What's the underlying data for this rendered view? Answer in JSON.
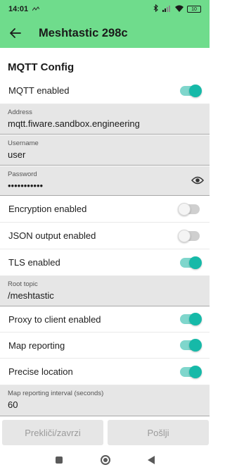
{
  "status_bar": {
    "time": "14:01",
    "battery": "10",
    "icons": [
      "activity-icon",
      "bluetooth-icon",
      "signal-icon",
      "wifi-icon",
      "battery-icon"
    ]
  },
  "app_bar": {
    "title": "Meshtastic 298c",
    "back_icon": "arrow-left-icon"
  },
  "section": {
    "title": "MQTT Config"
  },
  "settings": {
    "mqtt_enabled": {
      "label": "MQTT enabled",
      "on": true
    },
    "address": {
      "label": "Address",
      "value": "mqtt.fiware.sandbox.engineering"
    },
    "username": {
      "label": "Username",
      "value": "user"
    },
    "password": {
      "label": "Password",
      "value": "•••••••••••"
    },
    "encryption_enabled": {
      "label": "Encryption enabled",
      "on": false
    },
    "json_output_enabled": {
      "label": "JSON output enabled",
      "on": false
    },
    "tls_enabled": {
      "label": "TLS enabled",
      "on": true
    },
    "root_topic": {
      "label": "Root topic",
      "value": "/meshtastic"
    },
    "proxy_to_client": {
      "label": "Proxy to client enabled",
      "on": true
    },
    "map_reporting": {
      "label": "Map reporting",
      "on": true
    },
    "precise_location": {
      "label": "Precise location",
      "on": true
    },
    "map_interval": {
      "label": "Map reporting interval (seconds)",
      "value": "60"
    }
  },
  "buttons": {
    "cancel": "Prekliči/zavrzi",
    "send": "Pošlji"
  },
  "colors": {
    "header_bg": "#6fdc8c",
    "toggle_on": "#16b9a8",
    "field_bg": "#e6e6e6"
  }
}
